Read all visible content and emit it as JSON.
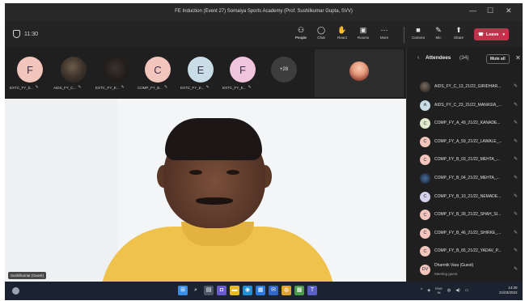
{
  "window": {
    "title": "FE Induction (Event 27) Somaiya Sports Academy (Prof. Sushilkumar Gupta, SVV)",
    "controls": [
      "—",
      "☐",
      "✕"
    ]
  },
  "toolbar": {
    "timer": "11:30",
    "buttons": [
      {
        "icon": "people-icon",
        "glyph": "⚇",
        "label": "People"
      },
      {
        "icon": "chat-icon",
        "glyph": "◯",
        "label": "Chat"
      },
      {
        "icon": "raise-hand-icon",
        "glyph": "✋",
        "label": "React"
      },
      {
        "icon": "rooms-icon",
        "glyph": "▣",
        "label": "Rooms"
      },
      {
        "icon": "more-icon",
        "glyph": "⋯",
        "label": "More"
      },
      {
        "icon": "camera-icon",
        "glyph": "■",
        "label": "Camera"
      },
      {
        "icon": "mic-icon",
        "glyph": "✎",
        "label": "Mic"
      },
      {
        "icon": "share-icon",
        "glyph": "⬆",
        "label": "Share"
      }
    ],
    "leave_label": "Leave"
  },
  "participants_strip": [
    {
      "initial": "F",
      "color": "#f3c6bd",
      "name": "EXTC_FY_E..."
    },
    {
      "initial": "",
      "color": "photo",
      "name": "AIDS_FY_C..."
    },
    {
      "initial": "",
      "color": "photo2",
      "name": "EXTC_FY_E..."
    },
    {
      "initial": "C",
      "color": "#f3c6bd",
      "name": "COMP_FY_B..."
    },
    {
      "initial": "E",
      "color": "#c9dde6",
      "name": "EXTC_FY_E..."
    },
    {
      "initial": "F",
      "color": "#f0c4dc",
      "name": "EXTC_FY_E..."
    }
  ],
  "more_count": "+28",
  "main_video": {
    "name": "Sushilkumar (Guest)"
  },
  "attendees_panel": {
    "title": "Attendees",
    "count": "(34)",
    "mute_all_label": "Mute all",
    "items": [
      {
        "avatar": "photo",
        "initial": "",
        "name": "AIDS_FY_C_13_21/22_GIRIDHAR..."
      },
      {
        "avatar": "#c9dde6",
        "initial": "A",
        "name": "AIDS_FY_C_23_21/22_MANASIA_..."
      },
      {
        "avatar": "#dfeacb",
        "initial": "C",
        "name": "COMP_FY_A_49_21/22_KANADE..."
      },
      {
        "avatar": "#f3c6bd",
        "initial": "C",
        "name": "COMP_FY_A_59_21/22_LAWALE_..."
      },
      {
        "avatar": "#f3c6bd",
        "initial": "C",
        "name": "COMP_FY_B_03_21/22_MEHTA_..."
      },
      {
        "avatar": "photo2",
        "initial": "",
        "name": "COMP_FY_B_04_21/22_MEHTA_..."
      },
      {
        "avatar": "#d6d2ee",
        "initial": "C",
        "name": "COMP_FY_B_10_21/22_NEMADE..."
      },
      {
        "avatar": "#f3c6bd",
        "initial": "C",
        "name": "COMP_FY_B_39_21/22_SHAH_SI..."
      },
      {
        "avatar": "#f3c6bd",
        "initial": "C",
        "name": "COMP_FY_B_46_21/22_SHIRKE_..."
      },
      {
        "avatar": "#f3c6bd",
        "initial": "C",
        "name": "COMP_FY_B_65_21/22_YADAV_P..."
      },
      {
        "avatar": "#f3c6bd",
        "initial": "DV",
        "name": "Dharmik Vara (Guest)",
        "sub": "Meeting guest"
      }
    ]
  },
  "taskbar": {
    "lang_top": "ENG",
    "lang_bottom": "IN",
    "time": "14:30",
    "date": "21/03/2022"
  },
  "colors": {
    "accent": "#c4314b",
    "background": "#1f1f1f"
  }
}
